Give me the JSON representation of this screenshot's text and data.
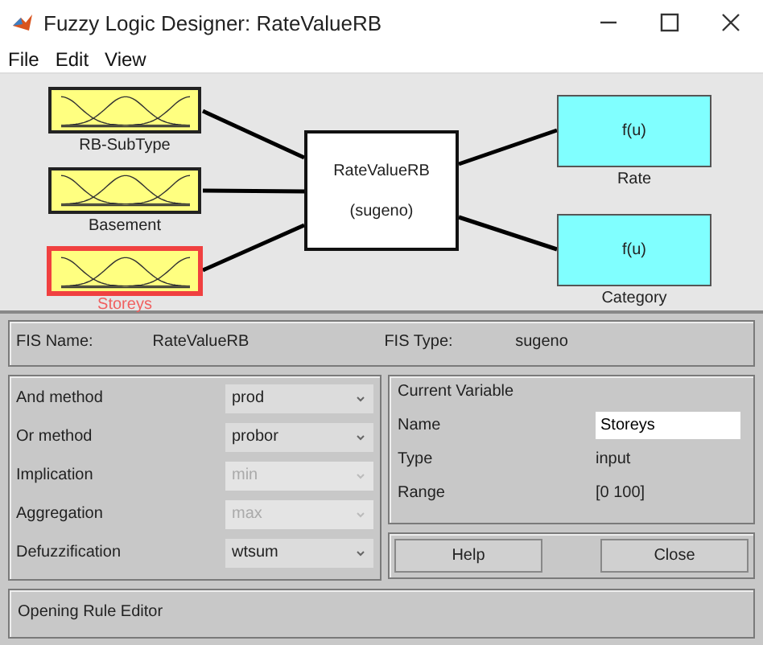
{
  "window": {
    "title": "Fuzzy Logic Designer: RateValueRB"
  },
  "menu": [
    "File",
    "Edit",
    "View"
  ],
  "diagram": {
    "inputs": [
      {
        "name": "RB-SubType",
        "selected": false
      },
      {
        "name": "Basement",
        "selected": false
      },
      {
        "name": "Storeys",
        "selected": true
      }
    ],
    "system": {
      "name": "RateValueRB",
      "type": "(sugeno)"
    },
    "outputs": [
      {
        "name": "Rate",
        "function": "f(u)"
      },
      {
        "name": "Category",
        "function": "f(u)"
      }
    ]
  },
  "fis": {
    "name_label": "FIS Name:",
    "name": "RateValueRB",
    "type_label": "FIS Type:",
    "type": "sugeno"
  },
  "methods": [
    {
      "label": "And method",
      "value": "prod",
      "disabled": false
    },
    {
      "label": "Or method",
      "value": "probor",
      "disabled": false
    },
    {
      "label": "Implication",
      "value": "min",
      "disabled": true
    },
    {
      "label": "Aggregation",
      "value": "max",
      "disabled": true
    },
    {
      "label": "Defuzzification",
      "value": "wtsum",
      "disabled": false
    }
  ],
  "current_variable": {
    "title": "Current Variable",
    "fields": [
      {
        "label": "Name",
        "value": "Storeys",
        "kind": "field"
      },
      {
        "label": "Type",
        "value": "input",
        "kind": "text"
      },
      {
        "label": "Range",
        "value": "[0 100]",
        "kind": "text"
      }
    ]
  },
  "buttons": [
    "Help",
    "Close"
  ],
  "status": "Opening Rule Editor"
}
